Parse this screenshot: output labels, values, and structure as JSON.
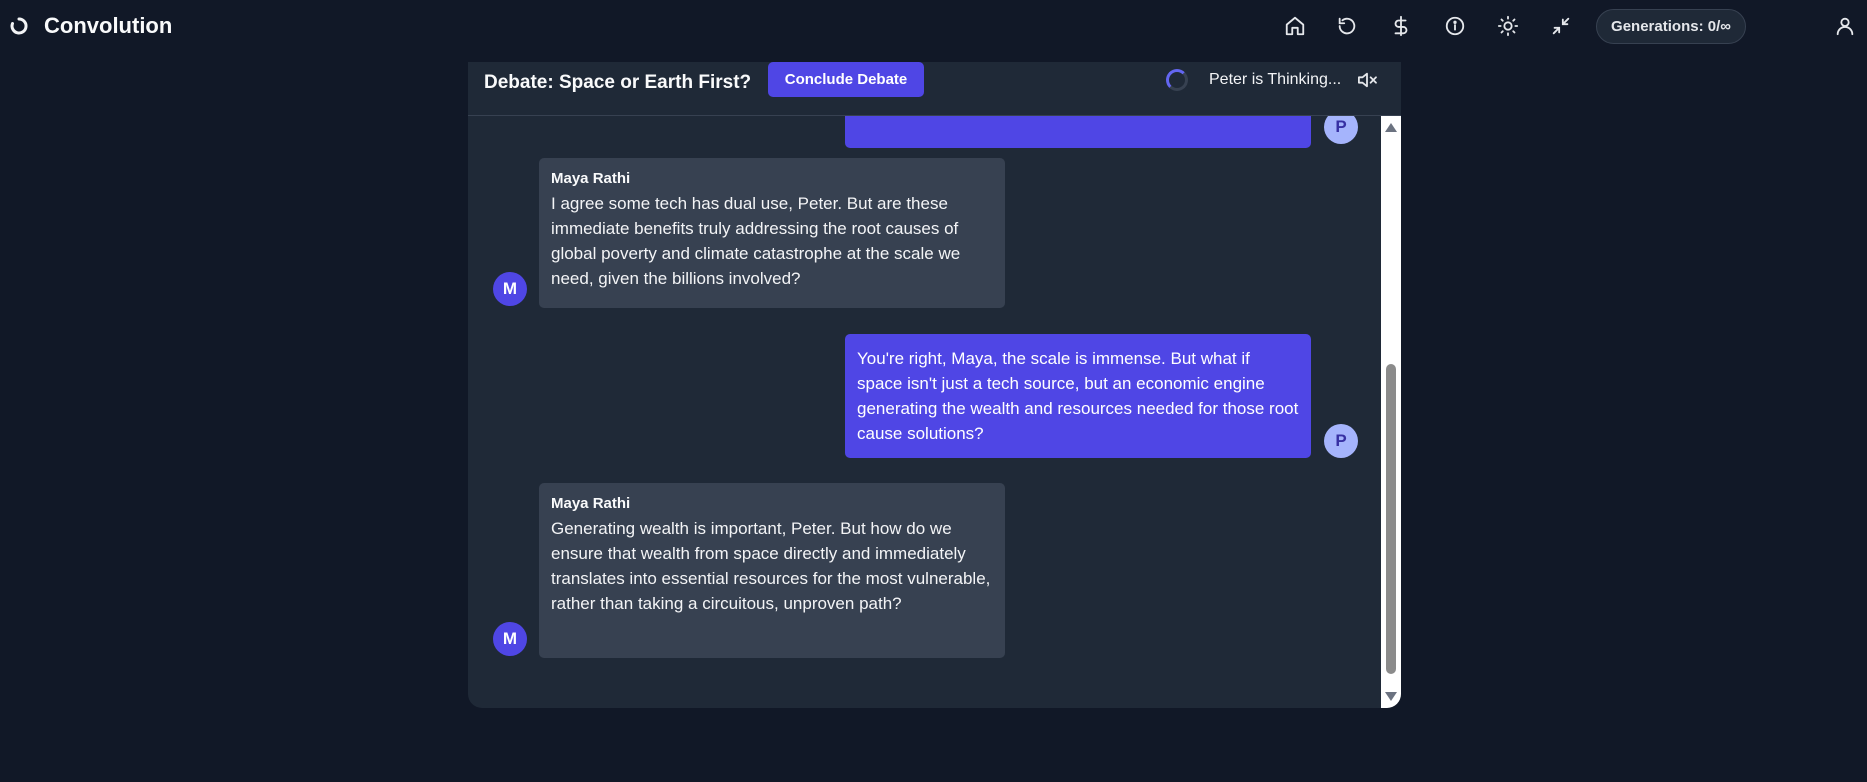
{
  "app": {
    "name": "Convolution",
    "generations_label": "Generations: 0/∞"
  },
  "nav": {
    "icons": [
      "home-icon",
      "history-icon",
      "dollar-icon",
      "info-icon",
      "sun-icon",
      "minimize-icon"
    ],
    "user_icon": "user-icon"
  },
  "debate": {
    "title": "Debate: Space or Earth First?",
    "conclude_label": "Conclude Debate",
    "status": "Peter is Thinking...",
    "mute_icon": "volume-mute-icon"
  },
  "messages": [
    {
      "speaker": "Peter",
      "avatar": "P",
      "side": "right",
      "text": "",
      "partial": true
    },
    {
      "speaker": "Maya Rathi",
      "avatar": "M",
      "side": "left",
      "text": "I agree some tech has dual use, Peter. But are these immediate benefits truly addressing the root causes of global poverty and climate catastrophe at the scale we need, given the billions involved?"
    },
    {
      "speaker": "Peter",
      "avatar": "P",
      "side": "right",
      "text": "You're right, Maya, the scale is immense. But what if space isn't just a tech source, but an economic engine generating the wealth and resources needed for those root cause solutions?"
    },
    {
      "speaker": "Maya Rathi",
      "avatar": "M",
      "side": "left",
      "text": "Generating wealth is important, Peter. But how do we ensure that wealth from space directly and immediately translates into essential resources for the most vulnerable, rather than taking a circuitous, unproven path?"
    }
  ],
  "colors": {
    "background": "#111827",
    "panel": "#1f2937",
    "ai_bubble": "#374151",
    "user_bubble": "#4f46e5",
    "accent": "#4f46e5"
  }
}
